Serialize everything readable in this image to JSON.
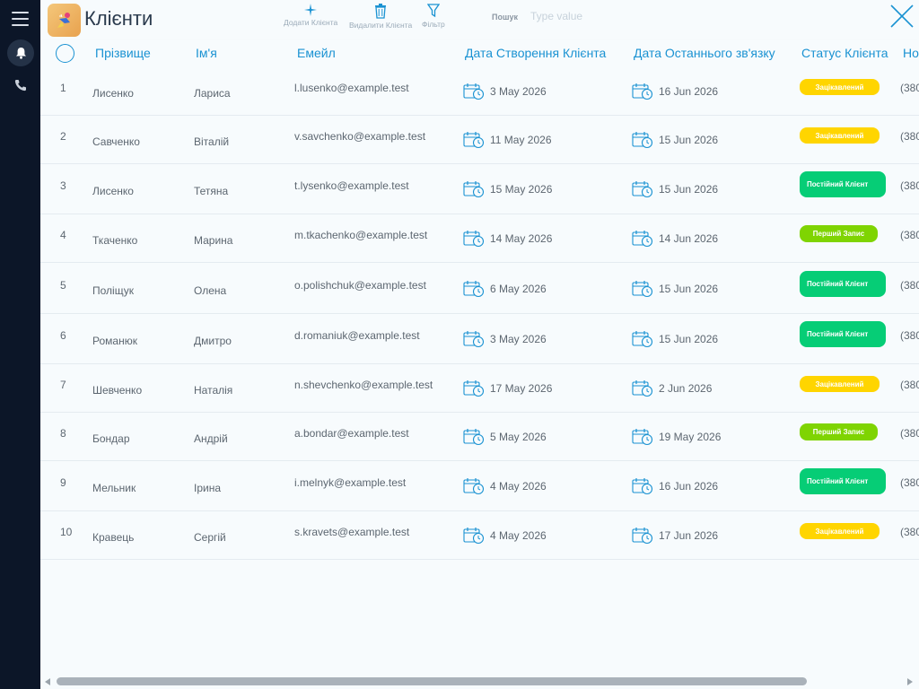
{
  "app": {
    "title": "Клієнти"
  },
  "toolbar": {
    "add_label": "Додати Клієнта",
    "delete_label": "Видалити Клієнта",
    "filter_label": "Фільтр",
    "search_label": "Пошук",
    "search_placeholder": "Type value"
  },
  "colors": {
    "accent": "#1a92d2",
    "sidebar": "#0c1628",
    "yellow": "#ffd500",
    "green": "#06cd76",
    "lime": "#7fd402"
  },
  "columns": [
    "Прізвище",
    "Ім'я",
    "Емейл",
    "Дата Створення Клієнта",
    "Дата Останнього зв'язку",
    "Статус Клієнта",
    "Но"
  ],
  "rows": [
    {
      "n": "1",
      "last": "Лисенко",
      "first": "Лариса",
      "email": "l.lusenko@example.test",
      "created": "3 May 2026",
      "contact": "16 Jun 2026",
      "status": "Зацікавлений",
      "status_type": "yellow",
      "phone": "(380"
    },
    {
      "n": "2",
      "last": "Савченко",
      "first": "Віталій",
      "email": "v.savchenko@example.test",
      "created": "11 May 2026",
      "contact": "15 Jun 2026",
      "status": "Зацікавлений",
      "status_type": "yellow",
      "phone": "(380"
    },
    {
      "n": "3",
      "last": "Лисенко",
      "first": "Тетяна",
      "email": "t.lysenko@example.test",
      "created": "15 May 2026",
      "contact": "15 Jun 2026",
      "status": "Постійний Клієнт",
      "status_type": "green",
      "phone": "(380"
    },
    {
      "n": "4",
      "last": "Ткаченко",
      "first": "Марина",
      "email": "m.tkachenko@example.test",
      "created": "14 May 2026",
      "contact": "14 Jun 2026",
      "status": "Перший Запис",
      "status_type": "lime",
      "phone": "(380"
    },
    {
      "n": "5",
      "last": "Поліщук",
      "first": "Олена",
      "email": "o.polishchuk@example.test",
      "created": "6 May 2026",
      "contact": "15 Jun 2026",
      "status": "Постійний Клієнт",
      "status_type": "green",
      "phone": "(380"
    },
    {
      "n": "6",
      "last": "Романюк",
      "first": "Дмитро",
      "email": "d.romaniuk@example.test",
      "created": "3 May 2026",
      "contact": "15 Jun 2026",
      "status": "Постійний Клієнт",
      "status_type": "green",
      "phone": "(380"
    },
    {
      "n": "7",
      "last": "Шевченко",
      "first": "Наталія",
      "email": "n.shevchenko@example.test",
      "created": "17 May 2026",
      "contact": "2 Jun 2026",
      "status": "Зацікавлений",
      "status_type": "yellow",
      "phone": "(380"
    },
    {
      "n": "8",
      "last": "Бондар",
      "first": "Андрій",
      "email": "a.bondar@example.test",
      "created": "5 May 2026",
      "contact": "19 May 2026",
      "status": "Перший Запис",
      "status_type": "lime",
      "phone": "(380"
    },
    {
      "n": "9",
      "last": "Мельник",
      "first": "Ірина",
      "email": "i.melnyk@example.test",
      "created": "4 May 2026",
      "contact": "16 Jun 2026",
      "status": "Постійний Клієнт",
      "status_type": "green",
      "phone": "(380"
    },
    {
      "n": "10",
      "last": "Кравець",
      "first": "Сергій",
      "email": "s.kravets@example.test",
      "created": "4 May 2026",
      "contact": "17 Jun 2026",
      "status": "Зацікавлений",
      "status_type": "yellow",
      "phone": "(380"
    }
  ]
}
